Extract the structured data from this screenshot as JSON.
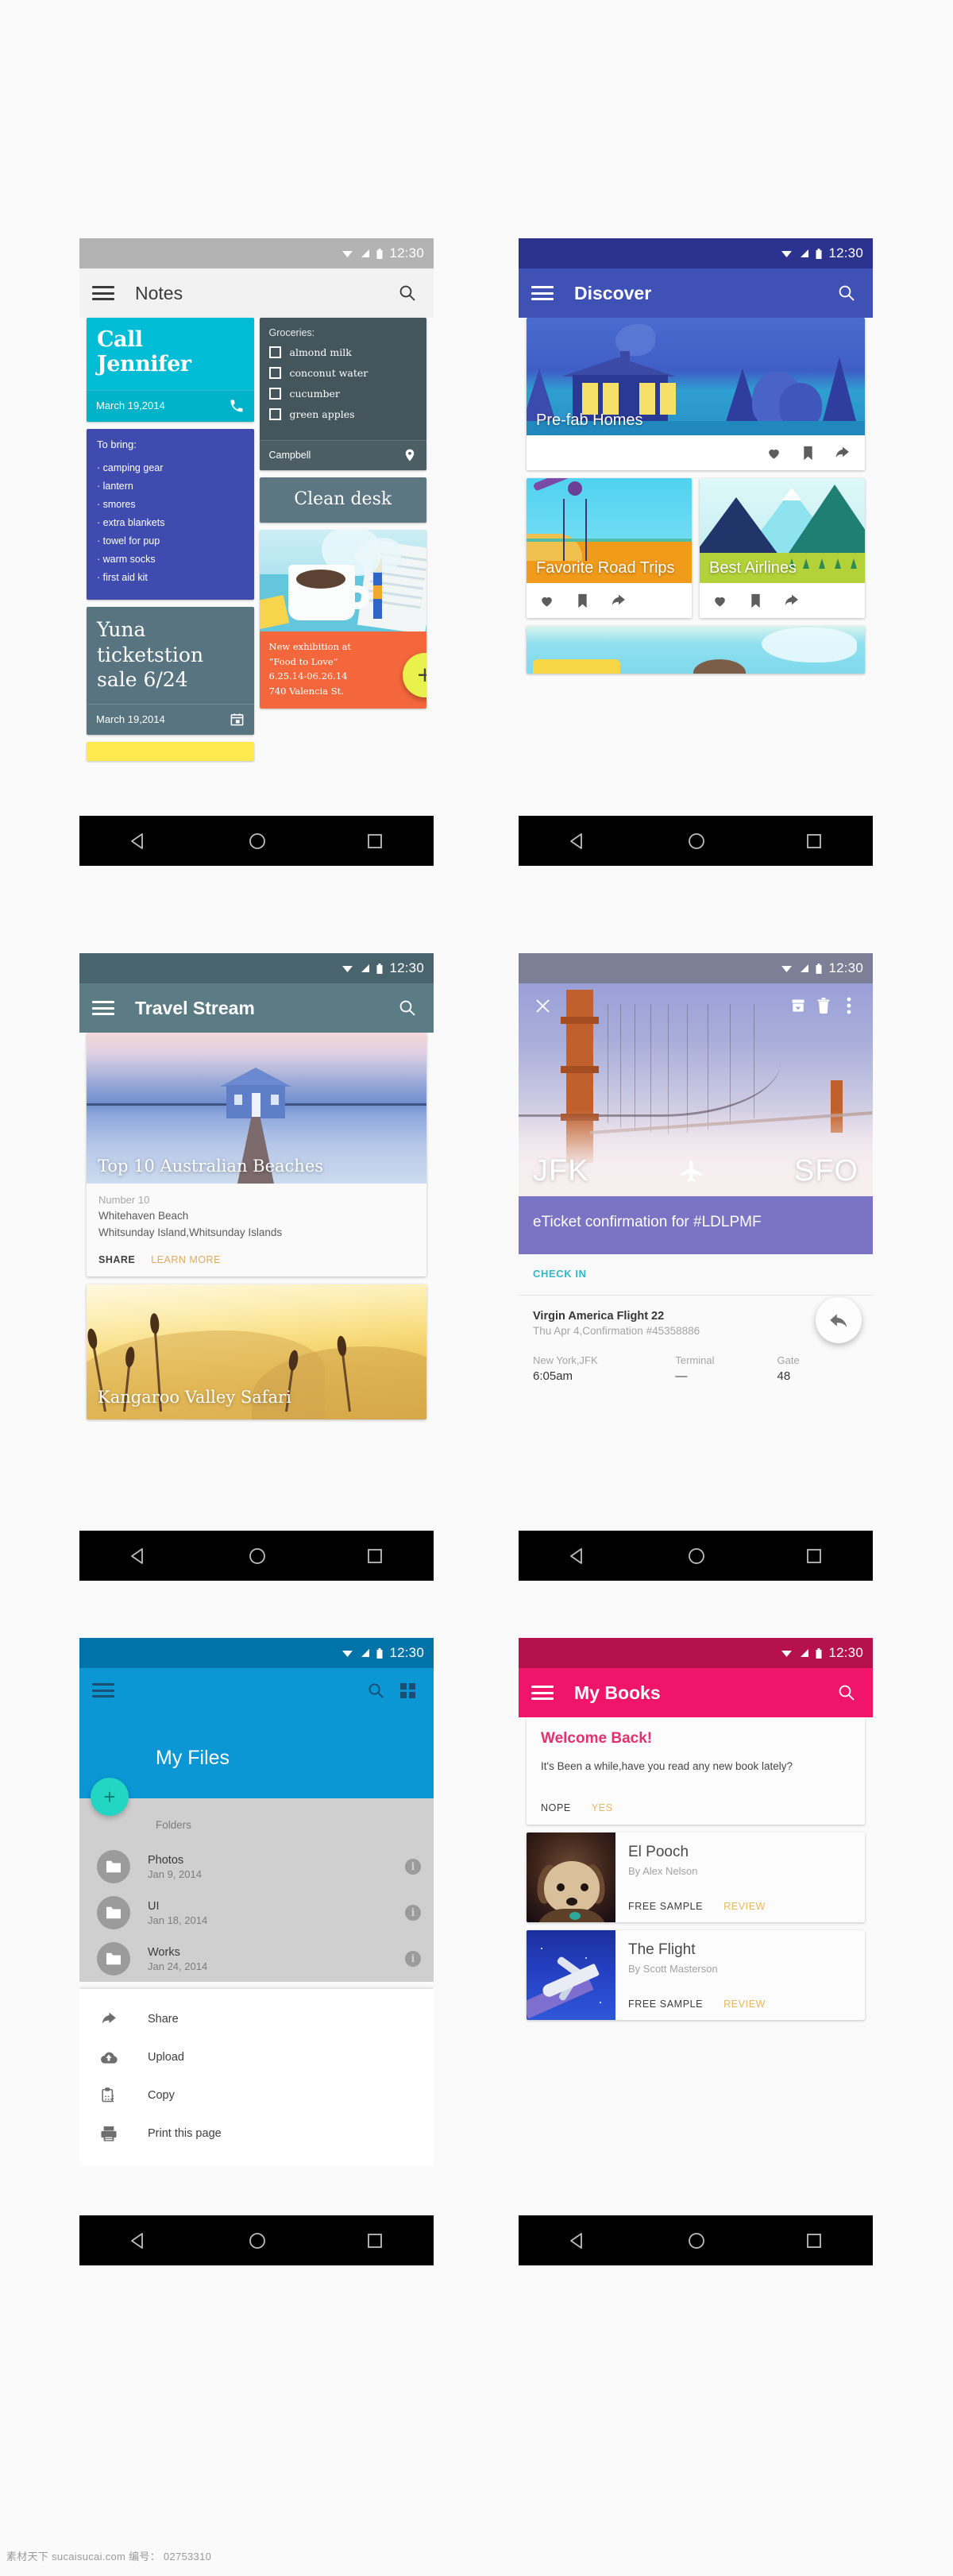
{
  "status_bar": {
    "time": "12:30",
    "icons": [
      "wifi-icon",
      "signal-icon",
      "battery-icon"
    ]
  },
  "nav_bar": {
    "back": "back-icon",
    "home": "home-icon",
    "recents": "recents-icon"
  },
  "screens": {
    "notes": {
      "title": "Notes",
      "menu_icon": "hamburger-icon",
      "search_icon": "search-icon",
      "cards": {
        "call": {
          "title": "Call Jennifer",
          "date": "March 19,2014",
          "action_icon": "phone-icon",
          "color": "#00bcd4"
        },
        "to_bring": {
          "label": "To bring:",
          "items": [
            "camping gear",
            "lantern",
            "smores",
            "extra blankets",
            "towel for pup",
            "warm socks",
            "first aid kit"
          ],
          "color": "#3f4bae"
        },
        "yuna": {
          "title": "Yuna ticketstion sale 6/24",
          "date": "March 19,2014",
          "action_icon": "calendar-icon",
          "color": "#577480"
        },
        "groceries": {
          "label": "Groceries:",
          "items": [
            "almond milk",
            "conconut water",
            "cucumber",
            "green apples"
          ],
          "place": "Campbell",
          "place_icon": "location-pin-icon",
          "color": "#44555c"
        },
        "clean_desk": {
          "title": "Clean desk",
          "color": "#5c7682"
        },
        "exhibition": {
          "lines": [
            "New exhibition at",
            "“Food to Love”",
            "6.25.14-06.26.14",
            "740 Valencia St."
          ],
          "color": "#f4673c",
          "fab_label": "+",
          "fab_color": "#e9f24c"
        }
      }
    },
    "discover": {
      "title": "Discover",
      "menu_icon": "hamburger-icon",
      "search_icon": "search-icon",
      "accent": "#3f51b5",
      "cards": [
        {
          "caption": "Pre-fab Homes",
          "actions": [
            "heart-icon",
            "bookmark-icon",
            "share-icon"
          ]
        },
        {
          "caption": "Favorite Road Trips",
          "actions": [
            "heart-icon",
            "bookmark-icon",
            "share-icon"
          ]
        },
        {
          "caption": "Best Airlines",
          "actions": [
            "heart-icon",
            "bookmark-icon",
            "share-icon"
          ]
        }
      ]
    },
    "travel_stream": {
      "title": "Travel Stream",
      "menu_icon": "hamburger-icon",
      "search_icon": "search-icon",
      "accent": "#5b7b85",
      "cards": [
        {
          "caption": "Top 10 Australian Beaches",
          "rank": "Number 10",
          "place": "Whitehaven Beach",
          "location": "Whitsunday Island,Whitsunday Islands",
          "action_primary": "SHARE",
          "action_secondary": "LEARN MORE"
        },
        {
          "caption": "Kangaroo Valley Safari"
        }
      ]
    },
    "eticket": {
      "close_icon": "close-icon",
      "archive_icon": "archive-icon",
      "delete_icon": "trash-icon",
      "more_icon": "overflow-menu-icon",
      "origin": "JFK",
      "plane_icon": "airplane-icon",
      "destination": "SFO",
      "headline": "eTicket confirmation for #LDLPMF",
      "band_color": "#7b73c4",
      "check_in": "CHECK IN",
      "flight": "Virgin America Flight 22",
      "confirmation": "Thu Apr 4,Confirmation #45358886",
      "details": [
        {
          "label": "New York,JFK",
          "value": "6:05am"
        },
        {
          "label": "Terminal",
          "value": "—"
        },
        {
          "label": "Gate",
          "value": "48"
        }
      ],
      "fab_icon": "reply-icon"
    },
    "my_files": {
      "title": "My Files",
      "menu_icon": "hamburger-icon",
      "search_icon": "search-icon",
      "grid_icon": "grid-view-icon",
      "accent": "#0b96d4",
      "fab_label": "+",
      "fab_color": "#23d6c4",
      "section_label": "Folders",
      "folders": [
        {
          "name": "Photos",
          "date": "Jan 9, 2014",
          "icon": "folder-icon",
          "info_icon": "info-icon"
        },
        {
          "name": "UI",
          "date": "Jan 18, 2014",
          "icon": "folder-icon",
          "info_icon": "info-icon"
        },
        {
          "name": "Works",
          "date": "Jan 24, 2014",
          "icon": "folder-icon",
          "info_icon": "info-icon"
        }
      ],
      "context_menu": [
        {
          "label": "Share",
          "icon": "share-icon"
        },
        {
          "label": "Upload",
          "icon": "cloud-upload-icon"
        },
        {
          "label": "Copy",
          "icon": "clipboard-copy-icon"
        },
        {
          "label": "Print this page",
          "icon": "printer-icon"
        }
      ]
    },
    "my_books": {
      "title": "My Books",
      "menu_icon": "hamburger-icon",
      "search_icon": "search-icon",
      "accent": "#f0156b",
      "welcome": {
        "heading": "Welcome Back!",
        "body": "It's Been a while,have you read any new book lately?",
        "action_no": "NOPE",
        "action_yes": "YES"
      },
      "books": [
        {
          "title": "El Pooch",
          "author": "By Alex Nelson",
          "action_primary": "FREE SAMPLE",
          "action_secondary": "REVIEW"
        },
        {
          "title": "The Flight",
          "author": "By Scott Masterson",
          "action_primary": "FREE SAMPLE",
          "action_secondary": "REVIEW"
        }
      ]
    }
  },
  "watermark": "素材天下 sucaisucai.com  编号： 02753310"
}
